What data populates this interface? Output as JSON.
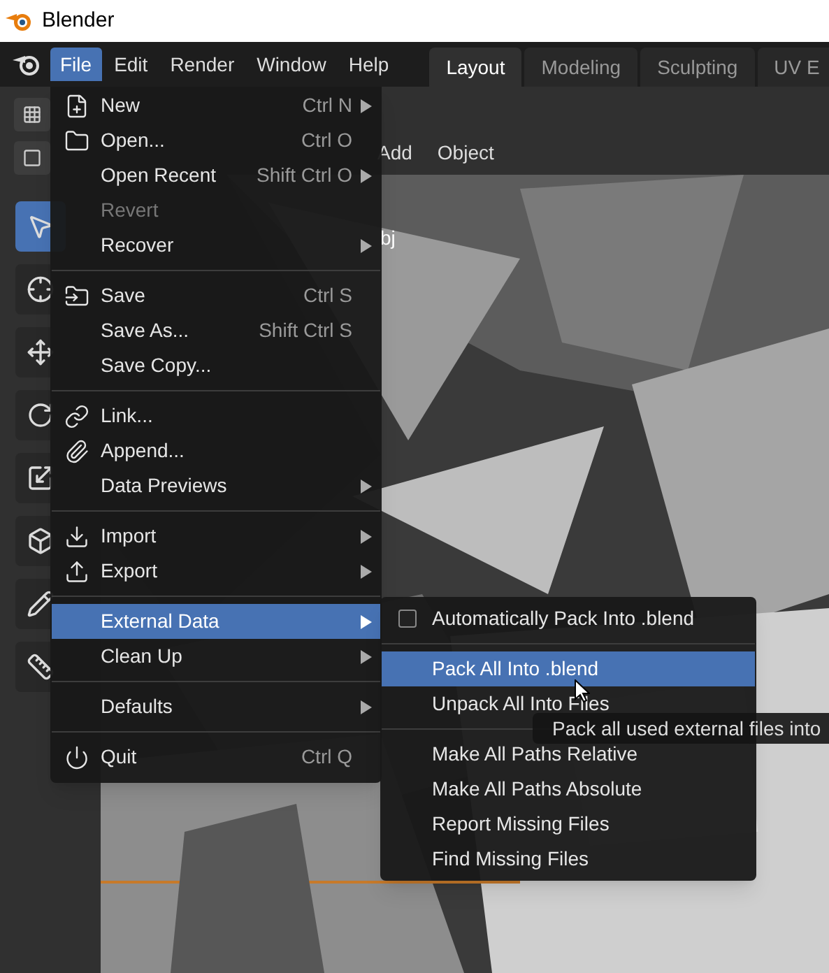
{
  "window": {
    "title": "Blender"
  },
  "menubar": [
    {
      "label": "File",
      "selected": true
    },
    {
      "label": "Edit",
      "selected": false
    },
    {
      "label": "Render",
      "selected": false
    },
    {
      "label": "Window",
      "selected": false
    },
    {
      "label": "Help",
      "selected": false
    }
  ],
  "workspace_tabs": [
    {
      "label": "Layout",
      "selected": true
    },
    {
      "label": "Modeling",
      "selected": false
    },
    {
      "label": "Sculpting",
      "selected": false
    },
    {
      "label": "UV E",
      "selected": false
    }
  ],
  "viewport_header": {
    "menus": [
      "Add",
      "Object"
    ],
    "overlay_text": "bj"
  },
  "file_menu": {
    "sections": [
      [
        {
          "label": "New",
          "shortcut": "Ctrl N",
          "kind": "new",
          "submenu": true,
          "disabled": false,
          "selected": false
        },
        {
          "label": "Open...",
          "shortcut": "Ctrl O",
          "kind": "open",
          "submenu": false,
          "disabled": false,
          "selected": false
        },
        {
          "label": "Open Recent",
          "shortcut": "Shift Ctrl O",
          "submenu": true,
          "disabled": false,
          "selected": false
        },
        {
          "label": "Revert",
          "submenu": false,
          "disabled": true,
          "selected": false
        },
        {
          "label": "Recover",
          "submenu": true,
          "disabled": false,
          "selected": false
        }
      ],
      [
        {
          "label": "Save",
          "shortcut": "Ctrl S",
          "kind": "save",
          "submenu": false,
          "disabled": false,
          "selected": false
        },
        {
          "label": "Save As...",
          "shortcut": "Shift Ctrl S",
          "submenu": false,
          "disabled": false,
          "selected": false
        },
        {
          "label": "Save Copy...",
          "submenu": false,
          "disabled": false,
          "selected": false
        }
      ],
      [
        {
          "label": "Link...",
          "kind": "link",
          "submenu": false,
          "disabled": false,
          "selected": false
        },
        {
          "label": "Append...",
          "kind": "append",
          "submenu": false,
          "disabled": false,
          "selected": false
        },
        {
          "label": "Data Previews",
          "submenu": true,
          "disabled": false,
          "selected": false
        }
      ],
      [
        {
          "label": "Import",
          "kind": "import",
          "submenu": true,
          "disabled": false,
          "selected": false
        },
        {
          "label": "Export",
          "kind": "export",
          "submenu": true,
          "disabled": false,
          "selected": false
        }
      ],
      [
        {
          "label": "External Data",
          "submenu": true,
          "disabled": false,
          "selected": true
        },
        {
          "label": "Clean Up",
          "submenu": true,
          "disabled": false,
          "selected": false
        }
      ],
      [
        {
          "label": "Defaults",
          "submenu": true,
          "disabled": false,
          "selected": false
        }
      ],
      [
        {
          "label": "Quit",
          "shortcut": "Ctrl Q",
          "kind": "quit",
          "submenu": false,
          "disabled": false,
          "selected": false
        }
      ]
    ]
  },
  "external_data_menu": {
    "sections": [
      [
        {
          "kind": "checkbox",
          "label": "Automatically Pack Into .blend",
          "checked": false,
          "selected": false
        }
      ],
      [
        {
          "kind": "action",
          "label": "Pack All Into .blend",
          "selected": true
        },
        {
          "kind": "action",
          "label": "Unpack All Into Files",
          "selected": false
        }
      ],
      [
        {
          "kind": "action",
          "label": "Make All Paths Relative",
          "selected": false
        },
        {
          "kind": "action",
          "label": "Make All Paths Absolute",
          "selected": false
        },
        {
          "kind": "action",
          "label": "Report Missing Files",
          "selected": false
        },
        {
          "kind": "action",
          "label": "Find Missing Files",
          "selected": false
        }
      ]
    ]
  },
  "tooltip": {
    "text": "Pack all used external files into"
  }
}
